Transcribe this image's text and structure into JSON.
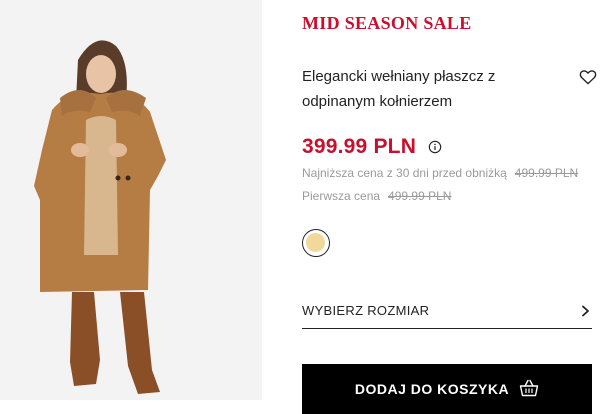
{
  "product": {
    "banner": "MID SEASON SALE",
    "title": "Elegancki wełniany płaszcz z odpinanym kołnierzem",
    "price": "399.99 PLN",
    "lowest_price_label": "Najniższa cena z 30 dni przed obniżką",
    "lowest_price_value": "499.99 PLN",
    "first_price_label": "Pierwsza cena",
    "first_price_value": "499.99 PLN",
    "swatch_color": "#f1d89b",
    "size_label": "WYBIERZ ROZMIAR",
    "add_to_cart_label": "DODAJ DO KOSZYKA"
  },
  "icons": {
    "wishlist": "heart-icon",
    "info": "info-icon",
    "size_chevron": "chevron-right-icon",
    "cart": "basket-icon"
  },
  "colors": {
    "sale_red": "#c8102e",
    "muted_gray": "#9a9a9a",
    "button_black": "#000000"
  }
}
